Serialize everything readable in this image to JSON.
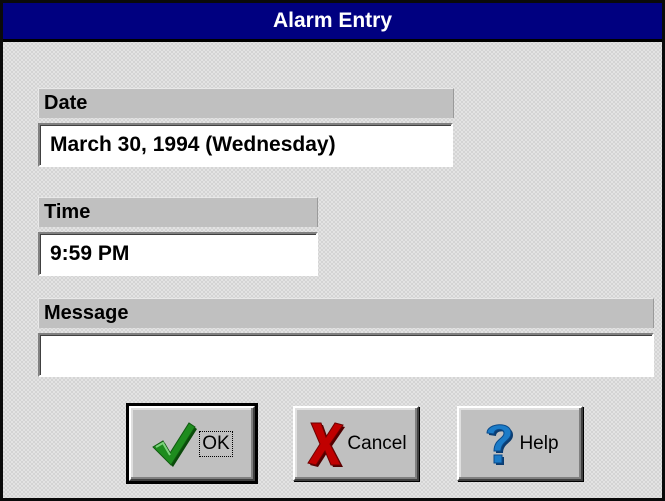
{
  "window": {
    "title": "Alarm Entry"
  },
  "fields": {
    "date": {
      "label": "Date",
      "value": "March 30, 1994 (Wednesday)"
    },
    "time": {
      "label": "Time",
      "value": "9:59 PM"
    },
    "message": {
      "label": "Message",
      "value": ""
    }
  },
  "buttons": {
    "ok": {
      "label": "OK",
      "icon": "checkmark-icon"
    },
    "cancel": {
      "label": "Cancel",
      "icon": "x-icon"
    },
    "help": {
      "label": "Help",
      "icon": "question-mark-icon"
    }
  },
  "colors": {
    "titlebar": "#000080",
    "checkmark": "#1e8c1e",
    "cancel_x": "#c00000",
    "help_q": "#1c7cc8"
  }
}
